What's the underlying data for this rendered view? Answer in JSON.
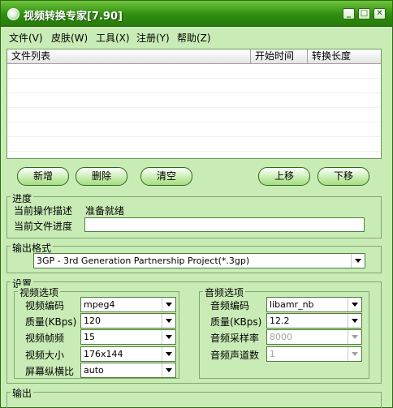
{
  "window": {
    "title": "视频转换专家[7.90]",
    "icon": "app-logo-icon",
    "minimize_glyph": "_",
    "maximize_glyph": "□",
    "close_glyph": "✕"
  },
  "colors": {
    "titlebar": "#2f8e10",
    "window_bg": "#c9ecb6",
    "button_bg": "#c4ecac",
    "border": "#2e6a12"
  },
  "menu": [
    {
      "label": "文件(V)"
    },
    {
      "label": "皮肤(W)"
    },
    {
      "label": "工具(X)"
    },
    {
      "label": "注册(Y)"
    },
    {
      "label": "帮助(Z)"
    }
  ],
  "filelist": {
    "columns": [
      "文件列表",
      "开始时间",
      "转换长度"
    ]
  },
  "buttons": {
    "add": "新增",
    "delete": "删除",
    "clear": "清空",
    "move_up": "上移",
    "move_down": "下移"
  },
  "progress": {
    "title": "进度",
    "op_label": "当前操作描述",
    "op_value": "准备就绪",
    "file_label": "当前文件进度"
  },
  "output_format": {
    "title": "输出格式",
    "selected": "3GP - 3rd Generation Partnership Project(*.3gp)"
  },
  "settings": {
    "title": "设置",
    "video": {
      "title": "视频选项",
      "codec_label": "视频编码",
      "codec": "mpeg4",
      "quality_label": "质量(KBps)",
      "quality": "120",
      "fps_label": "视频帧频",
      "fps": "15",
      "size_label": "视频大小",
      "size": "176x144",
      "aspect_label": "屏幕纵横比",
      "aspect": "auto"
    },
    "audio": {
      "title": "音频选项",
      "codec_label": "音频编码",
      "codec": "libamr_nb",
      "quality_label": "质量(KBps)",
      "quality": "12.2",
      "samplerate_label": "音频采样率",
      "samplerate": "8000",
      "channels_label": "音频声道数",
      "channels": "1"
    }
  },
  "output": {
    "title": "输出"
  }
}
